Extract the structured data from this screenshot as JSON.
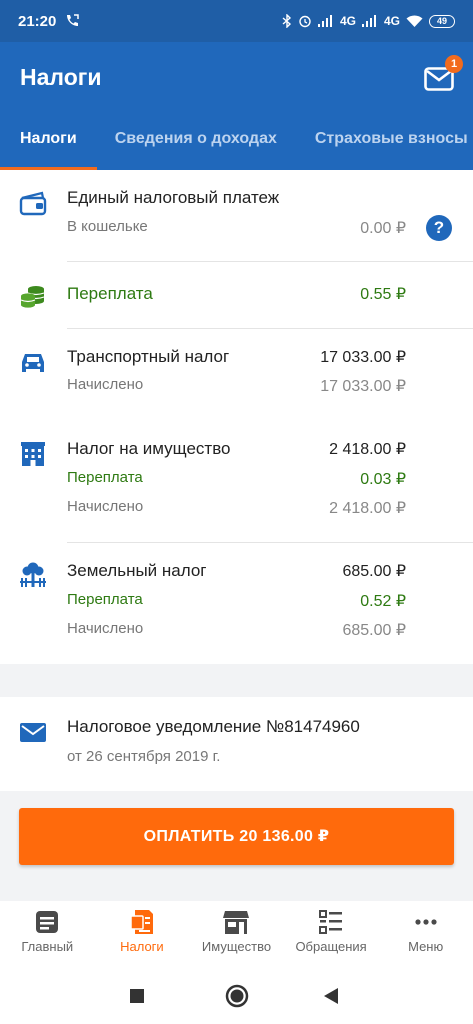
{
  "status": {
    "time": "21:20",
    "net1": "4G",
    "net2": "4G",
    "battery": "49"
  },
  "appbar": {
    "title": "Налоги",
    "mail_badge": "1"
  },
  "tabs": [
    {
      "label": "Налоги",
      "active": true
    },
    {
      "label": "Сведения о доходах",
      "active": false
    },
    {
      "label": "Страховые взносы",
      "active": false
    }
  ],
  "wallet": {
    "title": "Единый налоговый платеж",
    "sub_label": "В кошельке",
    "sub_amount": "0.00 ₽",
    "help_icon": "?"
  },
  "overpay": {
    "label": "Переплата",
    "amount": "0.55 ₽"
  },
  "transport": {
    "title": "Транспортный налог",
    "amount": "17 033.00 ₽",
    "accrued_label": "Начислено",
    "accrued_amount": "17 033.00 ₽"
  },
  "property": {
    "title": "Налог на имущество",
    "amount": "2 418.00 ₽",
    "overpay_label": "Переплата",
    "overpay_amount": "0.03 ₽",
    "accrued_label": "Начислено",
    "accrued_amount": "2 418.00 ₽"
  },
  "land": {
    "title": "Земельный налог",
    "amount": "685.00 ₽",
    "overpay_label": "Переплата",
    "overpay_amount": "0.52 ₽",
    "accrued_label": "Начислено",
    "accrued_amount": "685.00 ₽"
  },
  "notice": {
    "title": "Налоговое уведомление №81474960",
    "date": "от 26 сентября 2019 г."
  },
  "pay_button": "ОПЛАТИТЬ 20 136.00 ₽",
  "bottom_nav": [
    {
      "label": "Главный",
      "icon": "home-card-icon"
    },
    {
      "label": "Налоги",
      "icon": "tax-document-icon",
      "active": true
    },
    {
      "label": "Имущество",
      "icon": "shop-icon"
    },
    {
      "label": "Обращения",
      "icon": "list-icon"
    },
    {
      "label": "Меню",
      "icon": "more-icon"
    }
  ],
  "colors": {
    "primary": "#2068bb",
    "statusbar": "#1f5ea6",
    "accent": "#ff6a0c",
    "green": "#2e7a12"
  }
}
